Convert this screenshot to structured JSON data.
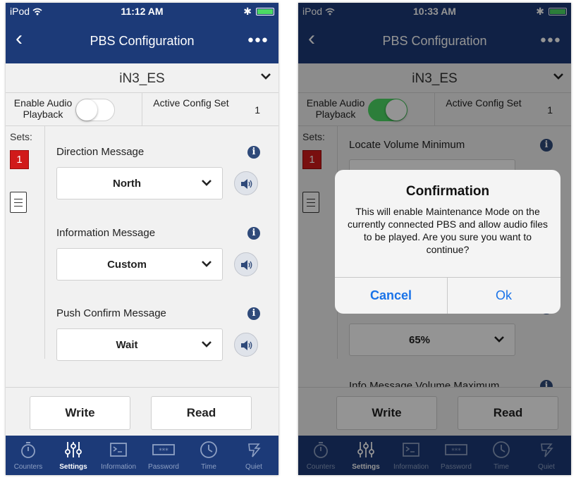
{
  "screens": [
    {
      "status": {
        "carrier": "iPod",
        "time": "11:12 AM"
      },
      "nav": {
        "title": "PBS Configuration",
        "more": "●●●"
      },
      "device": {
        "name": "iN3_ES"
      },
      "config": {
        "enable_audio_label": "Enable Audio Playback",
        "enable_audio_on": false,
        "active_config_label": "Active Config Set",
        "active_config_value": "1"
      },
      "sets": {
        "label": "Sets:",
        "active": "1"
      },
      "fields": [
        {
          "label": "Direction Message",
          "value": "North"
        },
        {
          "label": "Information Message",
          "value": "Custom"
        },
        {
          "label": "Push Confirm Message",
          "value": "Wait"
        }
      ],
      "buttons": {
        "write": "Write",
        "read": "Read"
      }
    },
    {
      "status": {
        "carrier": "iPod",
        "time": "10:33 AM"
      },
      "nav": {
        "title": "PBS Configuration",
        "more": "●●●"
      },
      "device": {
        "name": "iN3_ES"
      },
      "config": {
        "enable_audio_label": "Enable Audio Playback",
        "enable_audio_on": true,
        "active_config_label": "Active Config Set",
        "active_config_value": "1"
      },
      "sets": {
        "label": "Sets:",
        "active": "1"
      },
      "fields": [
        {
          "label": "Locate Volume Minimum",
          "value": ""
        },
        {
          "label": "",
          "value": ""
        },
        {
          "label": "",
          "value": "65%"
        },
        {
          "label": "Info Message Volume Maximum",
          "value": ""
        }
      ],
      "buttons": {
        "write": "Write",
        "read": "Read"
      },
      "dialog": {
        "title": "Confirmation",
        "message": "This will enable Maintenance Mode on the currently connected PBS and allow audio files to be played.  Are you sure you want to continue?",
        "cancel": "Cancel",
        "ok": "Ok"
      }
    }
  ],
  "tabs": [
    {
      "label": "Counters",
      "icon": "stopwatch-icon"
    },
    {
      "label": "Settings",
      "icon": "sliders-icon",
      "active": true
    },
    {
      "label": "Information",
      "icon": "terminal-icon"
    },
    {
      "label": "Password",
      "icon": "password-icon"
    },
    {
      "label": "Time",
      "icon": "clock-icon"
    },
    {
      "label": "Quiet",
      "icon": "quiet-icon"
    }
  ],
  "colors": {
    "nav_bar": "#1c3a78",
    "set_badge": "#d11a1a",
    "toggle_on": "#4cd964",
    "link": "#1a73e8",
    "tab_inactive": "#8ea0c3"
  }
}
